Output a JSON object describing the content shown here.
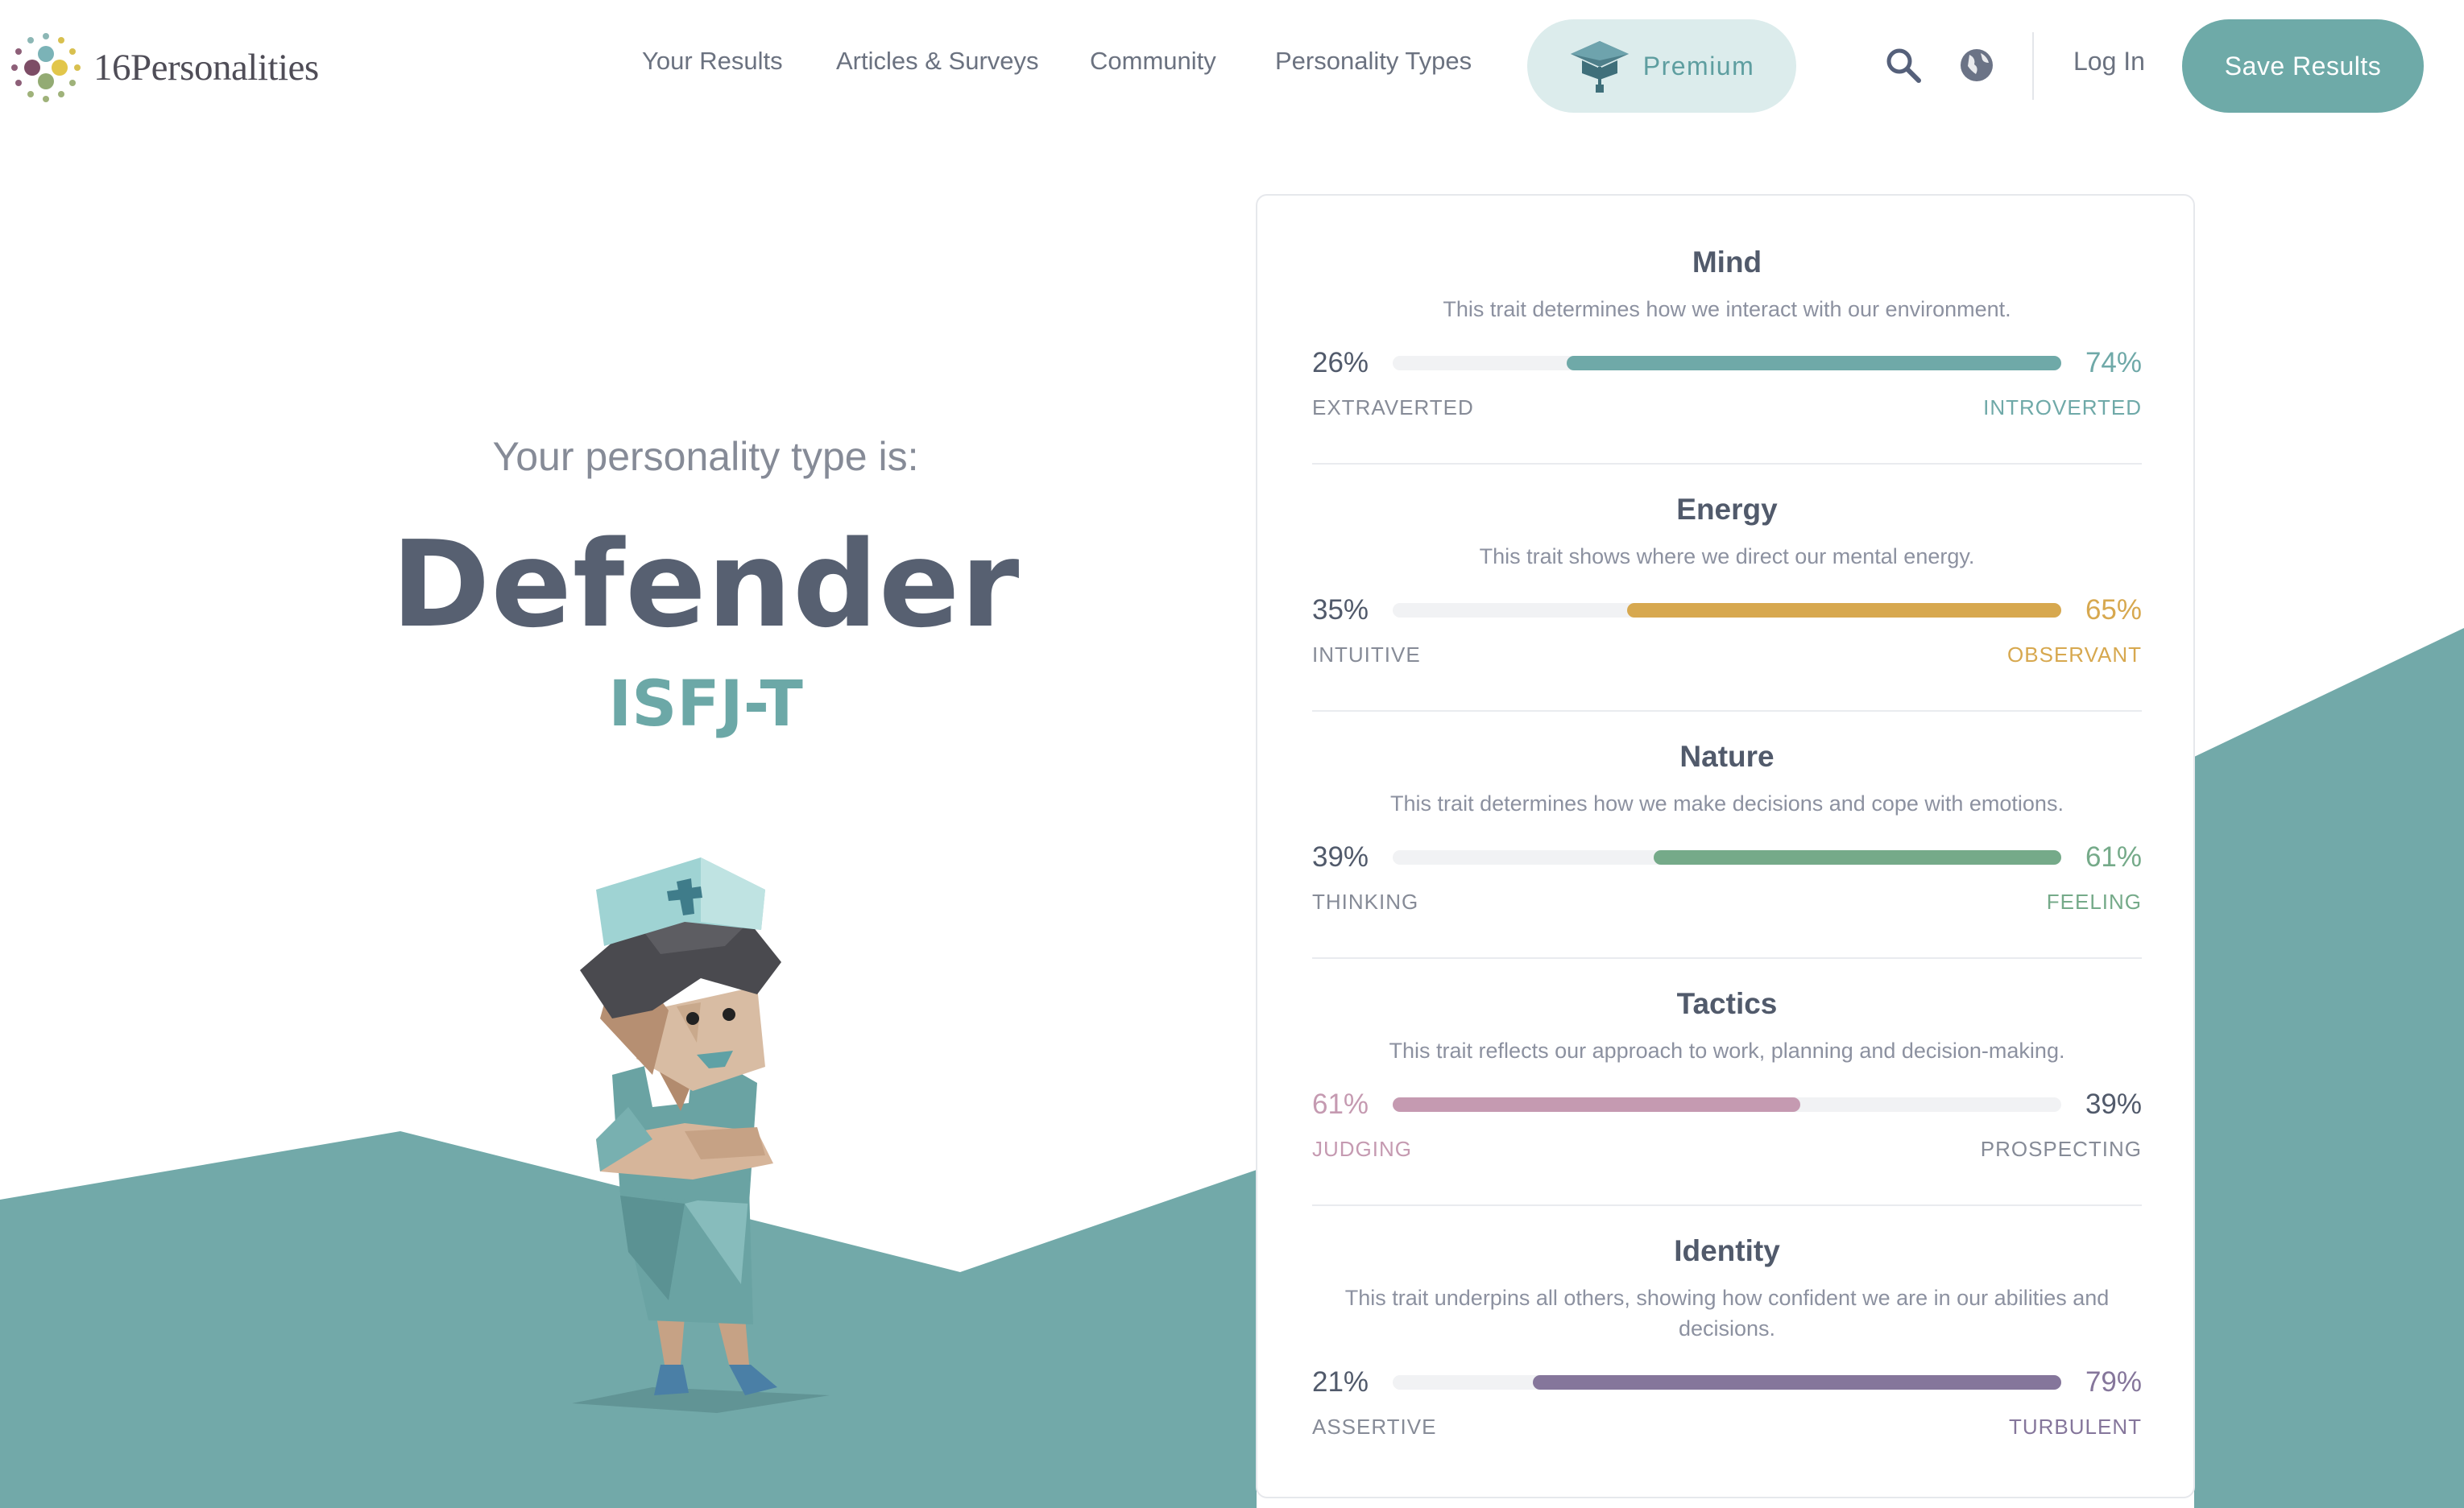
{
  "header": {
    "logo_text": "16Personalities",
    "nav": [
      "Your Results",
      "Articles & Surveys",
      "Community",
      "Personality Types"
    ],
    "premium_label": "Premium",
    "login_label": "Log In",
    "save_label": "Save Results"
  },
  "hero": {
    "subtitle": "Your personality type is:",
    "type_name": "Defender",
    "type_code": "ISFJ-T"
  },
  "traits": [
    {
      "title": "Mind",
      "desc": "This trait determines how we interact with our environment.",
      "left_pct": "26%",
      "right_pct": "74%",
      "left_label": "EXTRAVERTED",
      "right_label": "INTROVERTED",
      "dominant": "right",
      "value": 74,
      "color": "#6fa9a8"
    },
    {
      "title": "Energy",
      "desc": "This trait shows where we direct our mental energy.",
      "left_pct": "35%",
      "right_pct": "65%",
      "left_label": "INTUITIVE",
      "right_label": "OBSERVANT",
      "dominant": "right",
      "value": 65,
      "color": "#d7a84f"
    },
    {
      "title": "Nature",
      "desc": "This trait determines how we make decisions and cope with emotions.",
      "left_pct": "39%",
      "right_pct": "61%",
      "left_label": "THINKING",
      "right_label": "FEELING",
      "dominant": "right",
      "value": 61,
      "color": "#75aa89"
    },
    {
      "title": "Tactics",
      "desc": "This trait reflects our approach to work, planning and decision-making.",
      "left_pct": "61%",
      "right_pct": "39%",
      "left_label": "JUDGING",
      "right_label": "PROSPECTING",
      "dominant": "left",
      "value": 61,
      "color": "#c59ab1"
    },
    {
      "title": "Identity",
      "desc": "This trait underpins all others, showing how confident we are in our abilities and decisions.",
      "left_pct": "21%",
      "right_pct": "79%",
      "left_label": "ASSERTIVE",
      "right_label": "TURBULENT",
      "dominant": "right",
      "value": 79,
      "color": "#85769b"
    }
  ],
  "colors": {
    "accent": "#6eaaa8",
    "mountain": "#72a9a9",
    "text_dark": "#576071",
    "neutral_pct": "#515a6b",
    "neutral_label": "#868b97"
  },
  "icons": [
    "search-icon",
    "globe-icon",
    "graduation-cap-icon"
  ]
}
